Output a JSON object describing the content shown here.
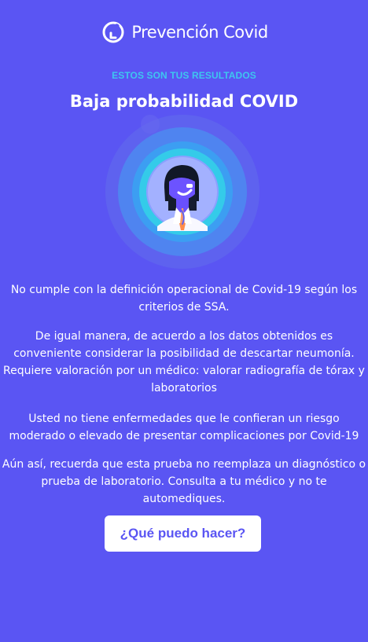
{
  "brand": {
    "name": "Prevención Covid",
    "logo_icon": "prevencion-covid-logo-icon"
  },
  "results": {
    "eyebrow": "ESTOS SON TUS RESULTADOS",
    "title": "Baja probabilidad COVID"
  },
  "illustration": {
    "icon": "doctor-avatar-icon"
  },
  "messages": [
    "No cumple con la definición operacional de Covid-19 según los criterios de SSA.",
    "De igual manera, de acuerdo a los datos obtenidos es conveniente considerar la posibilidad de descartar neumonía. Requiere valoración por un médico: valorar radiografía de tórax y laboratorios",
    "Usted no tiene enfermedades que le confieran un riesgo moderado o elevado de presentar complicaciones por Covid-19",
    "Aún así, recuerda que esta prueba no reemplaza un diagnóstico o prueba de laboratorio. Consulta a tu médico y no te automediques."
  ],
  "cta": {
    "label": "¿Qué puedo hacer?"
  },
  "colors": {
    "background": "#5a55f3",
    "accent": "#3ec6ef",
    "button_text": "#5a55f3"
  }
}
